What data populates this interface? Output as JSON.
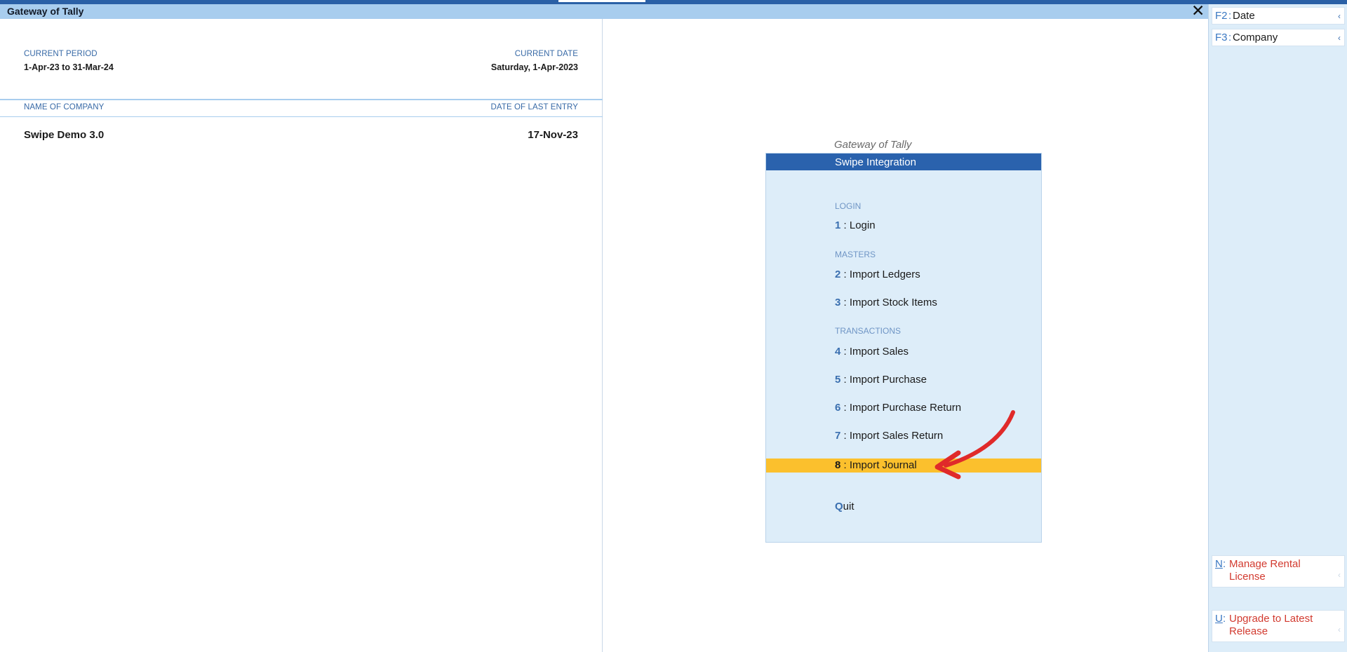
{
  "window": {
    "title": "Gateway of Tally",
    "close_glyph": "✕"
  },
  "left_panel": {
    "current_period_label": "CURRENT PERIOD",
    "current_period_value": "1-Apr-23 to 31-Mar-24",
    "current_date_label": "CURRENT DATE",
    "current_date_value": "Saturday, 1-Apr-2023",
    "company_col_label": "NAME OF COMPANY",
    "last_entry_col_label": "DATE OF LAST ENTRY",
    "company_name": "Swipe Demo 3.0",
    "last_entry_date": "17-Nov-23"
  },
  "menu": {
    "caption": "Gateway of Tally",
    "title": "Swipe Integration",
    "sections": {
      "login": "LOGIN",
      "masters": "MASTERS",
      "transactions": "TRANSACTIONS"
    },
    "items": [
      {
        "key": "1",
        "sep": " : ",
        "label": "Login"
      },
      {
        "key": "2",
        "sep": " : ",
        "label": "Import Ledgers"
      },
      {
        "key": "3",
        "sep": " : ",
        "label": "Import Stock Items"
      },
      {
        "key": "4",
        "sep": " : ",
        "label": "Import Sales"
      },
      {
        "key": "5",
        "sep": " : ",
        "label": "Import Purchase"
      },
      {
        "key": "6",
        "sep": " : ",
        "label": "Import Purchase Return"
      },
      {
        "key": "7",
        "sep": " : ",
        "label": "Import Sales Return"
      },
      {
        "key": "8",
        "sep": " : ",
        "label": "Import Journal"
      }
    ],
    "selected_index": 7,
    "quit": {
      "key": "Q",
      "rest": "uit"
    }
  },
  "right_bar": {
    "buttons_top": [
      {
        "key": "F2",
        "sep": ":",
        "label": "Date"
      },
      {
        "key": "F3",
        "sep": ":",
        "label": "Company"
      }
    ],
    "buttons_bottom": [
      {
        "key": "N",
        "sep": ":",
        "label": "Manage Rental License"
      },
      {
        "key": "U",
        "sep": ":",
        "label": "Upgrade to Latest Release"
      }
    ],
    "chevron": "‹"
  },
  "annotation": {
    "arrow_color": "#e02a2a",
    "highlight_color": "#fbc02d"
  }
}
